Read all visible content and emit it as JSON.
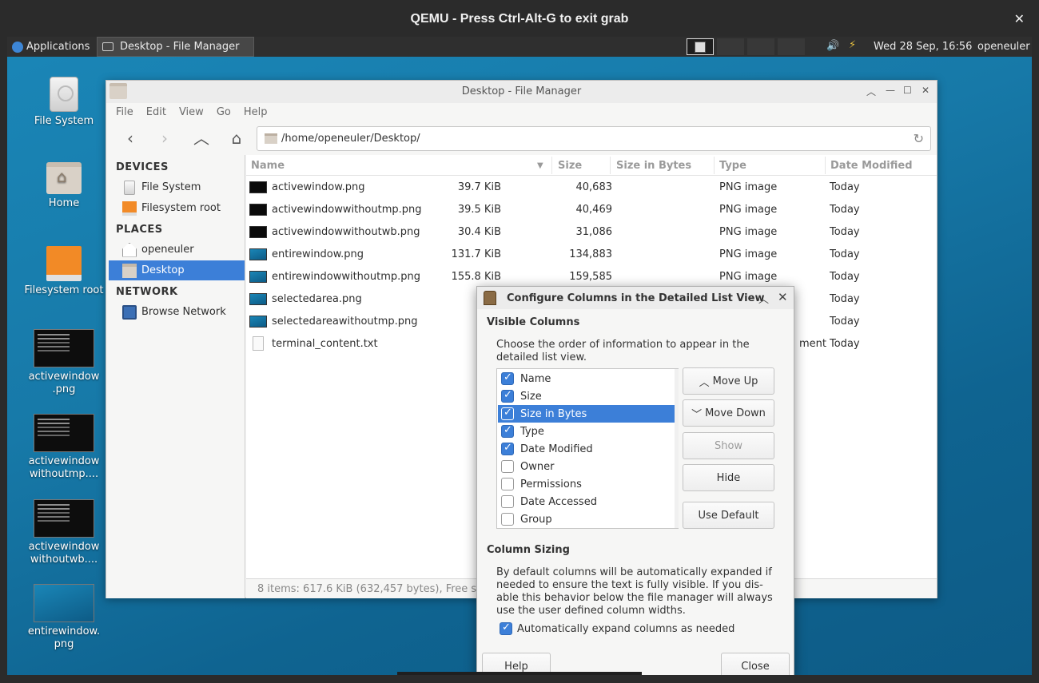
{
  "qemu": {
    "title": "QEMU - Press Ctrl-Alt-G to exit grab",
    "close_glyph": "✕"
  },
  "panel": {
    "apps_label": "Applications",
    "task_label": "Desktop - File Manager",
    "clock": "Wed 28 Sep, 16:56",
    "user": "openeuler"
  },
  "desktop_icons": [
    {
      "label": "File System"
    },
    {
      "label": "Home"
    },
    {
      "label": "Filesystem root"
    },
    {
      "label": "activewindow .png"
    },
    {
      "label": "activewindow withoutmp...."
    },
    {
      "label": "activewindow withoutwb...."
    },
    {
      "label": "entirewindow. png"
    }
  ],
  "file_manager": {
    "title": "Desktop - File Manager",
    "menu": [
      "File",
      "Edit",
      "View",
      "Go",
      "Help"
    ],
    "path": "/home/openeuler/Desktop/",
    "sidebar": {
      "devices_header": "DEVICES",
      "devices": [
        "File System",
        "Filesystem root"
      ],
      "places_header": "PLACES",
      "places": [
        "openeuler",
        "Desktop"
      ],
      "network_header": "NETWORK",
      "network": [
        "Browse Network"
      ]
    },
    "columns": [
      "Name",
      "Size",
      "Size in Bytes",
      "Type",
      "Date Modified"
    ],
    "files": [
      {
        "name": "activewindow.png",
        "size": "39.7 KiB",
        "bytes": "40,683",
        "type": "PNG image",
        "date": "Today"
      },
      {
        "name": "activewindowwithoutmp.png",
        "size": "39.5 KiB",
        "bytes": "40,469",
        "type": "PNG image",
        "date": "Today"
      },
      {
        "name": "activewindowwithoutwb.png",
        "size": "30.4 KiB",
        "bytes": "31,086",
        "type": "PNG image",
        "date": "Today"
      },
      {
        "name": "entirewindow.png",
        "size": "131.7 KiB",
        "bytes": "134,883",
        "type": "PNG image",
        "date": "Today"
      },
      {
        "name": "entirewindowwithoutmp.png",
        "size": "155.8 KiB",
        "bytes": "159,585",
        "type": "PNG image",
        "date": "Today"
      },
      {
        "name": "selectedarea.png",
        "size": "",
        "bytes": "",
        "type": "",
        "date": "Today"
      },
      {
        "name": "selectedareawithoutmp.png",
        "size": "",
        "bytes": "",
        "type": "",
        "date": "Today"
      },
      {
        "name": "terminal_content.txt",
        "size": "",
        "bytes": "",
        "type": "ment",
        "date": "Today"
      }
    ],
    "status": "8 items: 617.6 KiB (632,457 bytes), Free sp"
  },
  "dialog": {
    "title": "Configure Columns in the Detailed List View",
    "visible_header": "Visible Columns",
    "visible_desc": "Choose the order of information to appear in the detailed list view.",
    "columns": [
      {
        "label": "Name",
        "checked": true
      },
      {
        "label": "Size",
        "checked": true
      },
      {
        "label": "Size in Bytes",
        "checked": true
      },
      {
        "label": "Type",
        "checked": true
      },
      {
        "label": "Date Modified",
        "checked": true
      },
      {
        "label": "Owner",
        "checked": false
      },
      {
        "label": "Permissions",
        "checked": false
      },
      {
        "label": "Date Accessed",
        "checked": false
      },
      {
        "label": "Group",
        "checked": false
      }
    ],
    "selected_column": "Size in Bytes",
    "buttons": {
      "move_up": "Move Up",
      "move_down": "Move Down",
      "show": "Show",
      "hide": "Hide",
      "use_default": "Use Default",
      "help": "Help",
      "close": "Close"
    },
    "sizing_header": "Column Sizing",
    "sizing_desc": "By default columns will be automatically expanded if needed to ensure the text is fully visible. If you dis-able this behavior below the file manager will always use the user defined column widths.",
    "auto_expand_label": "Automatically expand columns as needed",
    "auto_expand_checked": true
  }
}
